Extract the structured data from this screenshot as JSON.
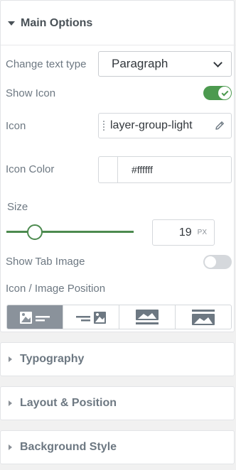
{
  "main_options": {
    "title": "Main Options",
    "text_type": {
      "label": "Change text type",
      "value": "Paragraph"
    },
    "show_icon": {
      "label": "Show Icon",
      "on": true
    },
    "icon": {
      "label": "Icon",
      "value": "layer-group-light"
    },
    "icon_color": {
      "label": "Icon Color",
      "value": "#ffffff",
      "swatch": "#ffffff"
    },
    "size": {
      "label": "Size",
      "value": "19",
      "unit": "PX",
      "level": 0.19
    },
    "show_tab_image": {
      "label": "Show Tab Image",
      "on": false
    },
    "position": {
      "label": "Icon / Image Position",
      "options": [
        "image-left",
        "image-right",
        "image-top",
        "image-bottom"
      ],
      "selected": "image-left"
    }
  },
  "sections": [
    {
      "title": "Typography"
    },
    {
      "title": "Layout & Position"
    },
    {
      "title": "Background Style"
    }
  ],
  "colors": {
    "accent_green": "#4c9a4f",
    "active_option": "#8a929b",
    "text": "#6d7882"
  }
}
